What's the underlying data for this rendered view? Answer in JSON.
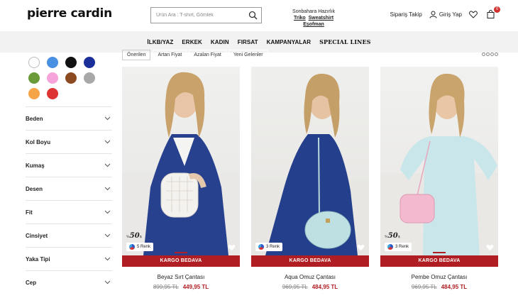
{
  "header": {
    "logo": "pierre cardin",
    "search_placeholder": "Ürün Ara : T-shirt, Gömlek",
    "promo_title": "Sonbahara Hazırlık",
    "promo_links": [
      "Triko",
      "Sweatshirt",
      "Eşofman"
    ],
    "order_track": "Sipariş Takip",
    "login": "Giriş Yap",
    "cart_count": "0"
  },
  "nav": [
    "İLKB/YAZ",
    "ERKEK",
    "KADIN",
    "FIRSAT",
    "KAMPANYALAR",
    "SPECIAL LINES"
  ],
  "sort": [
    "Önerilen",
    "Artan Fiyat",
    "Azalan Fiyat",
    "Yeni Gelenler"
  ],
  "colors": [
    "#ffffff",
    "#4a90e2",
    "#111111",
    "#1a2f9a",
    "#6a9a3a",
    "#f5a3d8",
    "#8b4a1f",
    "#a8a8a8",
    "#f5a545",
    "#dd3535"
  ],
  "filters": [
    "Beden",
    "Kol Boyu",
    "Kumaş",
    "Desen",
    "Fit",
    "Cinsiyet",
    "Yaka Tipi",
    "Cep"
  ],
  "products": [
    {
      "name": "Beyaz Sırt Çantası",
      "old_price": "899,95 TL",
      "new_price": "449,95 TL",
      "colors": "5 Renk",
      "shipping": "KARGO BEDAVA",
      "discount": "50",
      "discount_prefix": "%",
      "discount_suffix": "$"
    },
    {
      "name": "Aqua Omuz Çantası",
      "old_price": "969,95 TL",
      "new_price": "484,95 TL",
      "colors": "3 Renk",
      "shipping": "KARGO BEDAVA"
    },
    {
      "name": "Pembe Omuz Çantası",
      "old_price": "969,95 TL",
      "new_price": "484,95 TL",
      "colors": "3 Renk",
      "shipping": "KARGO BEDAVA",
      "discount": "50",
      "discount_prefix": "%",
      "discount_suffix": "$"
    }
  ]
}
